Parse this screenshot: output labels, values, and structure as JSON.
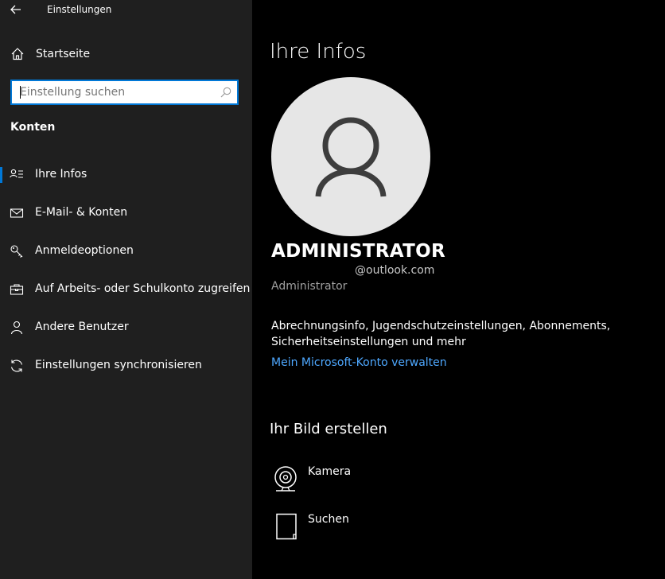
{
  "window": {
    "title": "Einstellungen"
  },
  "sidebar": {
    "home_label": "Startseite",
    "search": {
      "placeholder": "Einstellung suchen",
      "value": ""
    },
    "section_title": "Konten",
    "items": [
      {
        "label": "Ihre Infos",
        "icon": "user-info-icon",
        "active": true
      },
      {
        "label": "E-Mail- & Konten",
        "icon": "mail-icon",
        "active": false
      },
      {
        "label": "Anmeldeoptionen",
        "icon": "key-icon",
        "active": false
      },
      {
        "label": "Auf Arbeits- oder Schulkonto zugreifen",
        "icon": "briefcase-icon",
        "active": false
      },
      {
        "label": "Andere Benutzer",
        "icon": "person-icon",
        "active": false
      },
      {
        "label": "Einstellungen synchronisieren",
        "icon": "sync-icon",
        "active": false
      }
    ]
  },
  "main": {
    "title": "Ihre Infos",
    "avatar_icon": "user-avatar-icon",
    "user": {
      "name": "ADMINISTRATOR",
      "email": "@outlook.com",
      "role": "Administrator"
    },
    "info_text": "Abrechnungsinfo, Jugendschutzeinstellungen, Abonnements, Sicherheitseinstellungen und mehr",
    "manage_link": "Mein Microsoft-Konto verwalten",
    "picture_section": {
      "title": "Ihr Bild erstellen",
      "options": [
        {
          "label": "Kamera",
          "icon": "camera-icon"
        },
        {
          "label": "Suchen",
          "icon": "browse-icon"
        }
      ]
    }
  },
  "colors": {
    "sidebar_bg": "#1f1f1f",
    "main_bg": "#000000",
    "accent": "#0078d7",
    "link": "#4ea8ff",
    "avatar_bg": "#e6e6e6"
  }
}
